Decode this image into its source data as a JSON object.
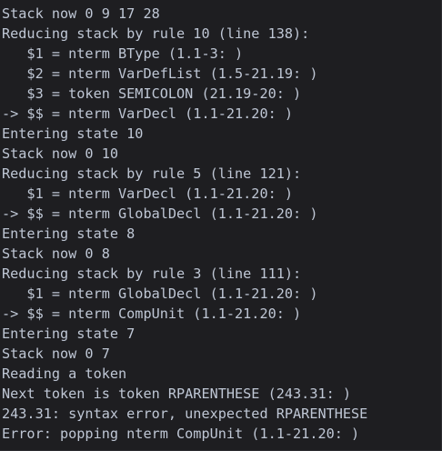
{
  "terminal": {
    "lines": [
      "Stack now 0 9 17 28",
      "Reducing stack by rule 10 (line 138):",
      "   $1 = nterm BType (1.1-3: )",
      "   $2 = nterm VarDefList (1.5-21.19: )",
      "   $3 = token SEMICOLON (21.19-20: )",
      "-> $$ = nterm VarDecl (1.1-21.20: )",
      "Entering state 10",
      "Stack now 0 10",
      "Reducing stack by rule 5 (line 121):",
      "   $1 = nterm VarDecl (1.1-21.20: )",
      "-> $$ = nterm GlobalDecl (1.1-21.20: )",
      "Entering state 8",
      "Stack now 0 8",
      "Reducing stack by rule 3 (line 111):",
      "   $1 = nterm GlobalDecl (1.1-21.20: )",
      "-> $$ = nterm CompUnit (1.1-21.20: )",
      "Entering state 7",
      "Stack now 0 7",
      "Reading a token",
      "Next token is token RPARENTHESE (243.31: )",
      "243.31: syntax error, unexpected RPARENTHESE",
      "Error: popping nterm CompUnit (1.1-21.20: )"
    ]
  }
}
